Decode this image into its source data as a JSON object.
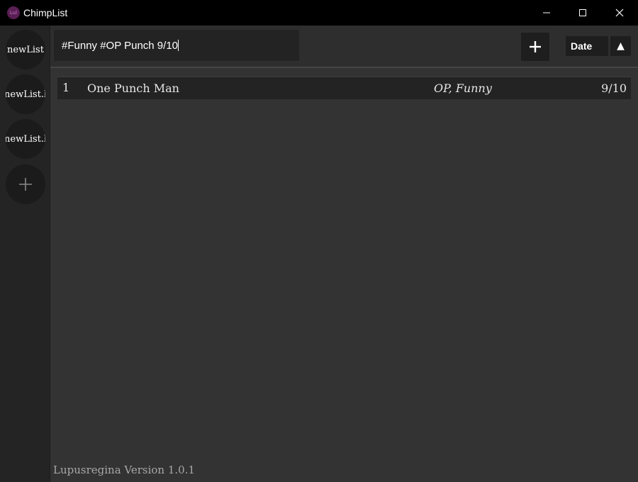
{
  "window": {
    "title": "ChimpList",
    "logo_text": "Lul"
  },
  "sidebar": {
    "lists": [
      {
        "label": "newList"
      },
      {
        "label": "newList.b"
      },
      {
        "label": "newList.b"
      }
    ],
    "add_icon": "plus-icon"
  },
  "toolbar": {
    "search_value": "#Funny #OP Punch 9/10",
    "add_icon": "plus-icon",
    "sort_label": "Date",
    "sort_direction": "▲"
  },
  "entries": [
    {
      "number": "1",
      "name": "One Punch Man",
      "tags": "OP, Funny",
      "rating": "9/10"
    }
  ],
  "footer": {
    "version": "Lupusregina Version 1.0.1"
  },
  "colors": {
    "titlebar": "#000000",
    "sidebar": "#242424",
    "main": "#333333",
    "row": "#232323"
  }
}
